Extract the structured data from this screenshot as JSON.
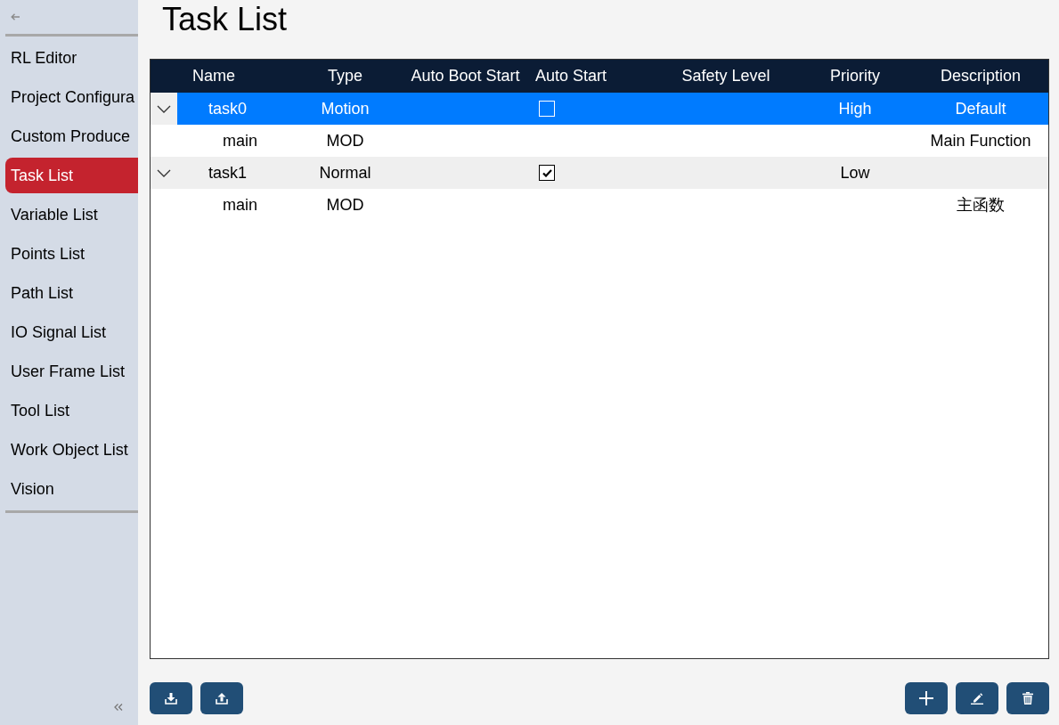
{
  "sidebar": {
    "items": [
      {
        "label": "RL Editor",
        "selected": false
      },
      {
        "label": "Project Configura",
        "selected": false
      },
      {
        "label": "Custom Produce",
        "selected": false
      },
      {
        "label": "Task List",
        "selected": true
      },
      {
        "label": "Variable List",
        "selected": false
      },
      {
        "label": "Points List",
        "selected": false
      },
      {
        "label": "Path List",
        "selected": false
      },
      {
        "label": "IO Signal List",
        "selected": false
      },
      {
        "label": "User Frame List",
        "selected": false
      },
      {
        "label": "Tool List",
        "selected": false
      },
      {
        "label": "Work Object List",
        "selected": false
      },
      {
        "label": "Vision",
        "selected": false
      }
    ]
  },
  "page_title": "Task List",
  "table": {
    "columns": [
      "Name",
      "Type",
      "Auto Boot Start",
      "Auto Start",
      "Safety Level",
      "Priority",
      "Description"
    ],
    "rows": [
      {
        "name": "task0",
        "type": "Motion",
        "auto_start": {
          "checked": false
        },
        "priority": "High",
        "description": "Default",
        "selected": true,
        "hovered": false,
        "expanded": true,
        "children": [
          {
            "name": "main",
            "type": "MOD",
            "description": "Main Function"
          }
        ]
      },
      {
        "name": "task1",
        "type": "Normal",
        "auto_start": {
          "checked": true
        },
        "priority": "Low",
        "selected": false,
        "hovered": true,
        "expanded": true,
        "children": [
          {
            "name": "main",
            "type": "MOD",
            "description": "主函数"
          }
        ]
      }
    ]
  },
  "toolbar": {
    "left": [
      {
        "kind": "import"
      },
      {
        "kind": "export"
      }
    ],
    "right": [
      {
        "kind": "add"
      },
      {
        "kind": "edit"
      },
      {
        "kind": "delete"
      }
    ]
  }
}
